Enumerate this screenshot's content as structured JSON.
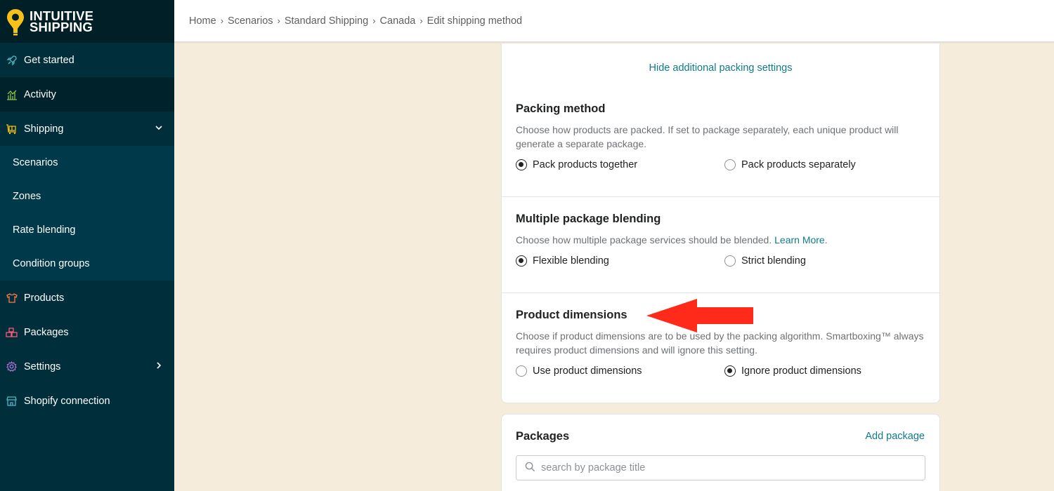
{
  "brand": {
    "line1": "INTUITIVE",
    "line2": "SHIPPING"
  },
  "sidebar": {
    "items": [
      {
        "label": "Get started",
        "icon": "rocket-icon"
      },
      {
        "label": "Activity",
        "icon": "chart-icon"
      },
      {
        "label": "Shipping",
        "icon": "truck-icon",
        "expanded": true
      },
      {
        "label": "Products",
        "icon": "shirt-icon"
      },
      {
        "label": "Packages",
        "icon": "boxes-icon"
      },
      {
        "label": "Settings",
        "icon": "gear-icon"
      },
      {
        "label": "Shopify connection",
        "icon": "store-icon"
      }
    ],
    "shipping_sub": [
      "Scenarios",
      "Zones",
      "Rate blending",
      "Condition groups"
    ]
  },
  "breadcrumb": [
    "Home",
    "Scenarios",
    "Standard Shipping",
    "Canada",
    "Edit shipping method"
  ],
  "packing_card": {
    "hide_link": "Hide additional packing settings",
    "packing_method": {
      "title": "Packing method",
      "desc": "Choose how products are packed. If set to package separately, each unique product will generate a separate package.",
      "opt1": "Pack products together",
      "opt2": "Pack products separately",
      "selected": 1
    },
    "blending": {
      "title": "Multiple package blending",
      "desc": "Choose how multiple package services should be blended.",
      "learn_more": "Learn More",
      "desc_end": ".",
      "opt1": "Flexible blending",
      "opt2": "Strict blending",
      "selected": 1
    },
    "dimensions": {
      "title": "Product dimensions",
      "desc": "Choose if product dimensions are to be used by the packing algorithm. Smartboxing™ always requires product dimensions and will ignore this setting.",
      "opt1": "Use product dimensions",
      "opt2": "Ignore product dimensions",
      "selected": 2
    }
  },
  "packages_card": {
    "title": "Packages",
    "add_label": "Add package",
    "search_placeholder": "search by package title"
  },
  "colors": {
    "sidebar": "#002e3b",
    "accent_link": "#0f7b8a",
    "background": "#f5ecdc",
    "arrow": "#ff2a1a",
    "logo_yellow": "#f6c21a"
  }
}
